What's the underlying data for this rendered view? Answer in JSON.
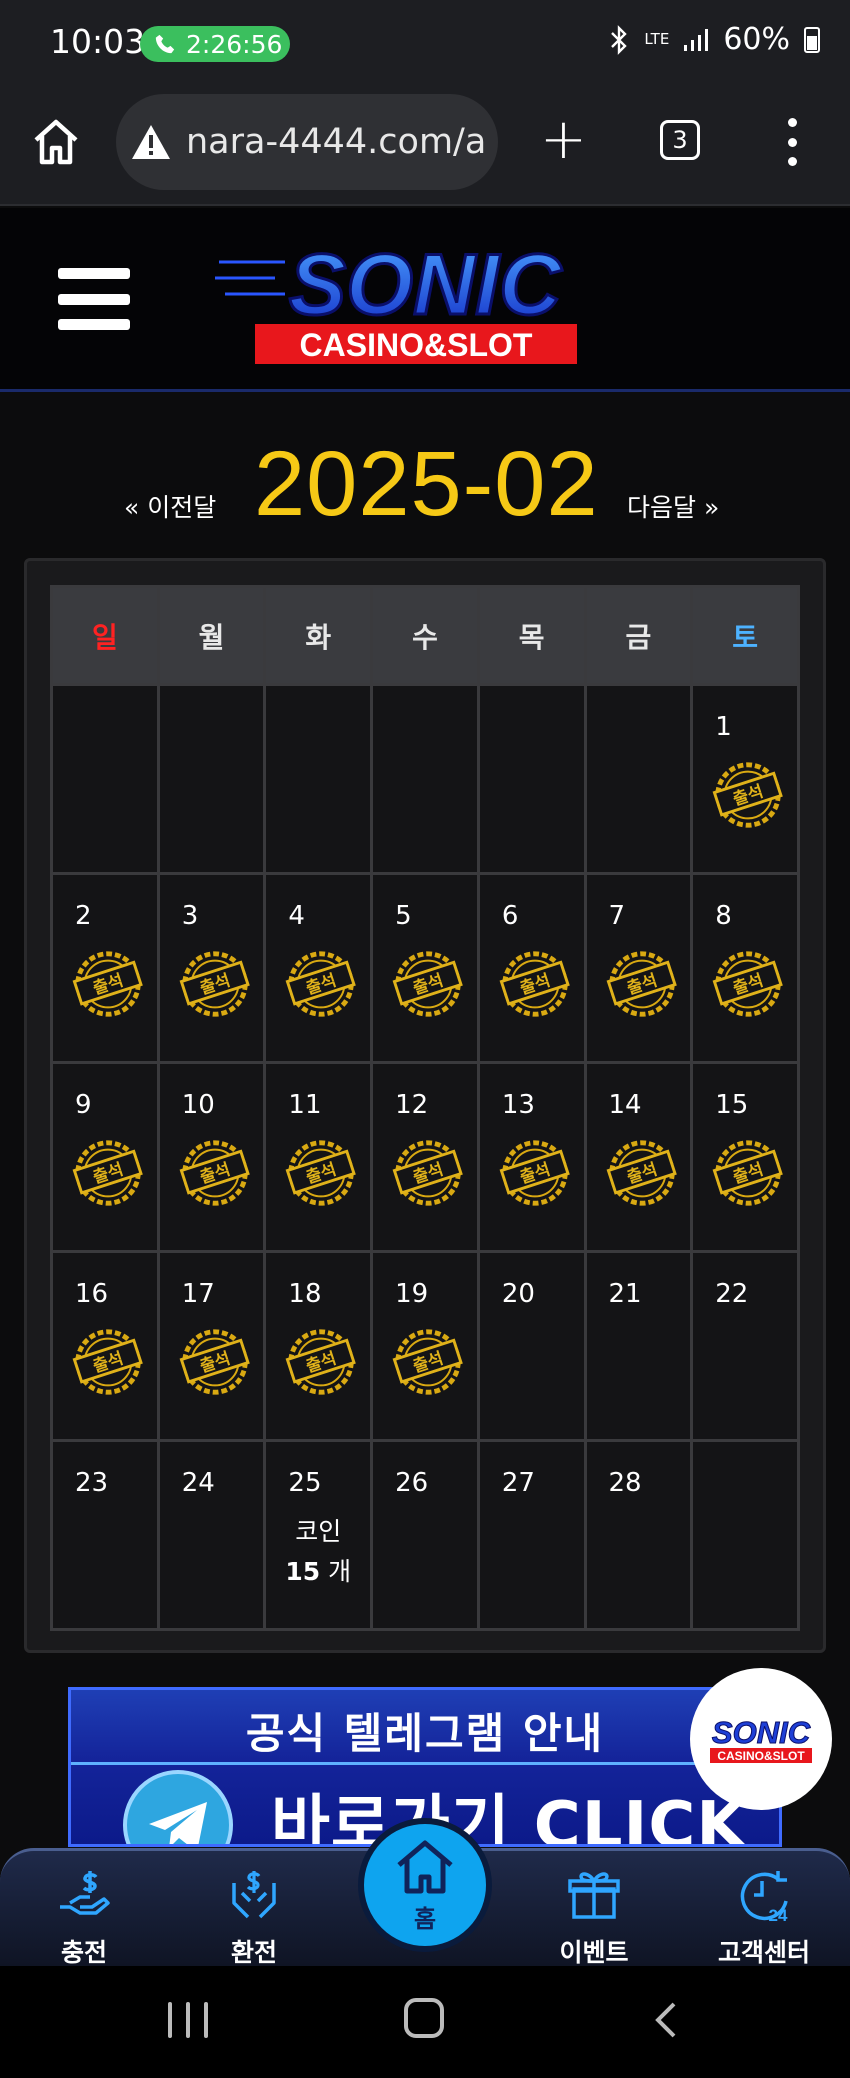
{
  "status_bar": {
    "time": "10:03",
    "call_timer": "2:26:56",
    "network": "LTE",
    "battery": "60%"
  },
  "browser": {
    "url": "nara-4444.com/a",
    "tab_count": "3"
  },
  "header": {
    "logo_text": "SONIC",
    "logo_sub": "CASINO&SLOT"
  },
  "calendar": {
    "prev_label": "« 이전달",
    "title": "2025-02",
    "next_label": "다음달 »",
    "weekdays": [
      "일",
      "월",
      "화",
      "수",
      "목",
      "금",
      "토"
    ],
    "stamp_label": "출석",
    "weeks": [
      [
        {
          "day": ""
        },
        {
          "day": ""
        },
        {
          "day": ""
        },
        {
          "day": ""
        },
        {
          "day": ""
        },
        {
          "day": ""
        },
        {
          "day": "1",
          "stamp": true
        }
      ],
      [
        {
          "day": "2",
          "stamp": true
        },
        {
          "day": "3",
          "stamp": true
        },
        {
          "day": "4",
          "stamp": true
        },
        {
          "day": "5",
          "stamp": true
        },
        {
          "day": "6",
          "stamp": true
        },
        {
          "day": "7",
          "stamp": true
        },
        {
          "day": "8",
          "stamp": true
        }
      ],
      [
        {
          "day": "9",
          "stamp": true
        },
        {
          "day": "10",
          "stamp": true
        },
        {
          "day": "11",
          "stamp": true
        },
        {
          "day": "12",
          "stamp": true
        },
        {
          "day": "13",
          "stamp": true
        },
        {
          "day": "14",
          "stamp": true
        },
        {
          "day": "15",
          "stamp": true
        }
      ],
      [
        {
          "day": "16",
          "stamp": true
        },
        {
          "day": "17",
          "stamp": true
        },
        {
          "day": "18",
          "stamp": true
        },
        {
          "day": "19",
          "stamp": true
        },
        {
          "day": "20"
        },
        {
          "day": "21"
        },
        {
          "day": "22"
        }
      ],
      [
        {
          "day": "23"
        },
        {
          "day": "24"
        },
        {
          "day": "25",
          "coin_label": "코인",
          "coin_count": "15",
          "coin_unit": "개"
        },
        {
          "day": "26"
        },
        {
          "day": "27"
        },
        {
          "day": "28"
        },
        {
          "day": ""
        }
      ]
    ]
  },
  "banner": {
    "title": "공식 텔레그램 안내",
    "cta": "바로가기 CLICK",
    "float_logo_text": "SONIC",
    "float_logo_sub": "CASINO&SLOT"
  },
  "bottom_nav": {
    "items": [
      {
        "label": "충전",
        "icon": "deposit-icon"
      },
      {
        "label": "환전",
        "icon": "withdraw-icon"
      },
      {
        "label": "홈",
        "icon": "home-icon"
      },
      {
        "label": "이벤트",
        "icon": "gift-icon"
      },
      {
        "label": "고객센터",
        "icon": "support-24-icon"
      }
    ]
  },
  "colors": {
    "accent_gold": "#f6c916",
    "sunday": "#ff2222",
    "saturday": "#4db2ff",
    "nav_blue": "#0ea4ef"
  }
}
